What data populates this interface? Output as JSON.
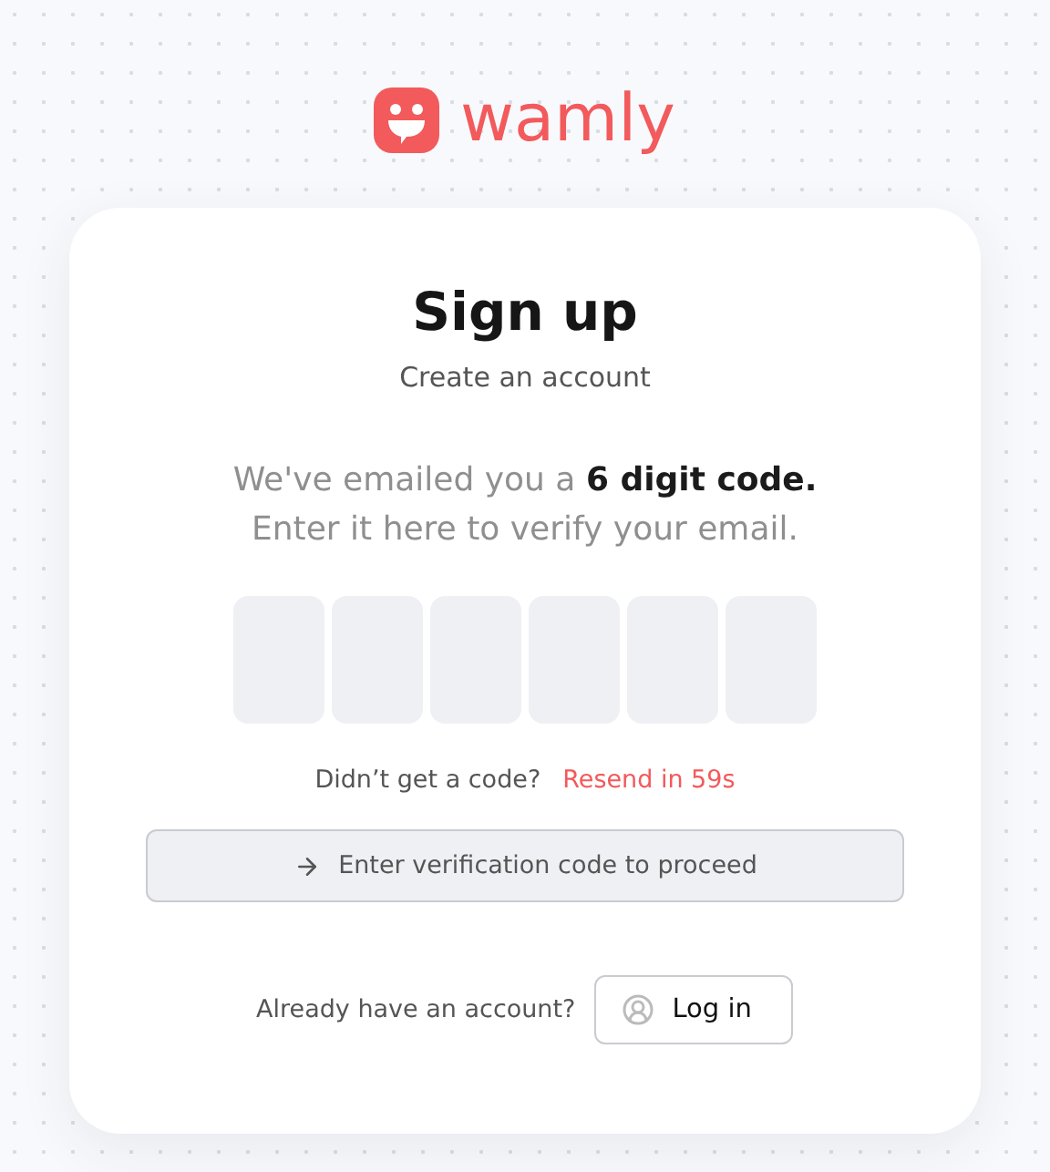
{
  "logo": {
    "wordmark": "wamly"
  },
  "card": {
    "title": "Sign up",
    "subtitle": "Create an account",
    "message": [
      "We've emailed you a **6 digit code.**",
      "Enter it here to verify your email."
    ],
    "code_boxes": [
      {
        "focused": false
      },
      {
        "focused": false
      },
      {
        "focused": false
      },
      {
        "focused": false
      },
      {
        "focused": false
      },
      {
        "focused": false
      }
    ],
    "resend": {
      "prompt": "Didn’t get a code?",
      "link": "Resend in 59s"
    },
    "submit": {
      "label": "Enter verification code to proceed",
      "disabled": true
    },
    "login": {
      "prompt": "Already have an account?",
      "button": "Log in"
    }
  }
}
